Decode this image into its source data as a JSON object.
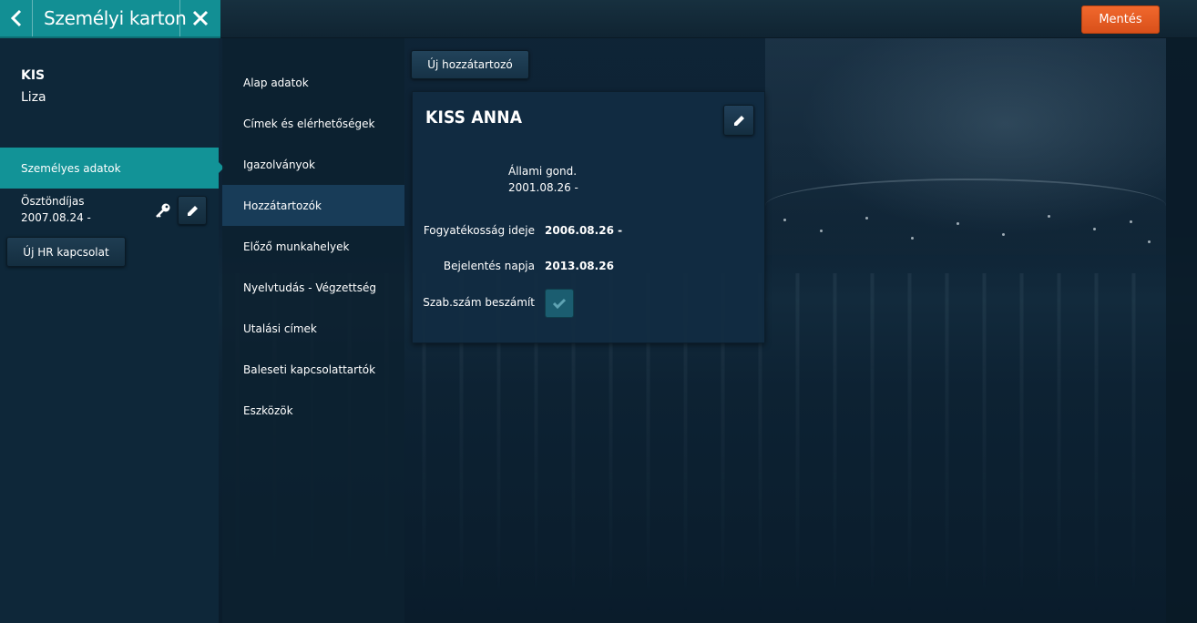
{
  "header": {
    "title": "Személyi karton",
    "save_label": "Mentés"
  },
  "person": {
    "last_name": "KIS",
    "first_name": "Liza"
  },
  "sidebar": {
    "active_item": "Személyes adatok",
    "relation": {
      "title": "Ösztöndíjas",
      "date": "2007.08.24 -"
    },
    "new_hr_label": "Új HR kapcsolat"
  },
  "nav": {
    "items": [
      {
        "label": "Alap adatok",
        "active": false
      },
      {
        "label": "Címek és elérhetőségek",
        "active": false
      },
      {
        "label": "Igazolványok",
        "active": false
      },
      {
        "label": "Hozzátartozók",
        "active": true
      },
      {
        "label": "Előző munkahelyek",
        "active": false
      },
      {
        "label": "Nyelvtudás - Végzettség",
        "active": false
      },
      {
        "label": "Utalási címek",
        "active": false
      },
      {
        "label": "Baleseti kapcsolattartók",
        "active": false
      },
      {
        "label": "Eszközök",
        "active": false
      }
    ]
  },
  "content": {
    "new_member_label": "Új hozzátartozó",
    "card": {
      "name": "KISS ANNA",
      "status_line1": "Állami gond.",
      "status_line2": "2001.08.26 -",
      "fields": [
        {
          "label": "Fogyatékosság ideje",
          "value": "2006.08.26 -"
        },
        {
          "label": "Bejelentés napja",
          "value": "2013.08.26"
        }
      ],
      "checkbox_label": "Szab.szám beszámít",
      "checkbox_checked": true
    }
  },
  "colors": {
    "accent_teal": "#129397",
    "save_orange": "#e85d22",
    "active_nav": "#183c58"
  },
  "icons": {
    "back": "chevron-left-icon",
    "close": "close-icon",
    "edit": "pencil-icon",
    "key": "key-icon",
    "check": "checkmark-icon"
  }
}
